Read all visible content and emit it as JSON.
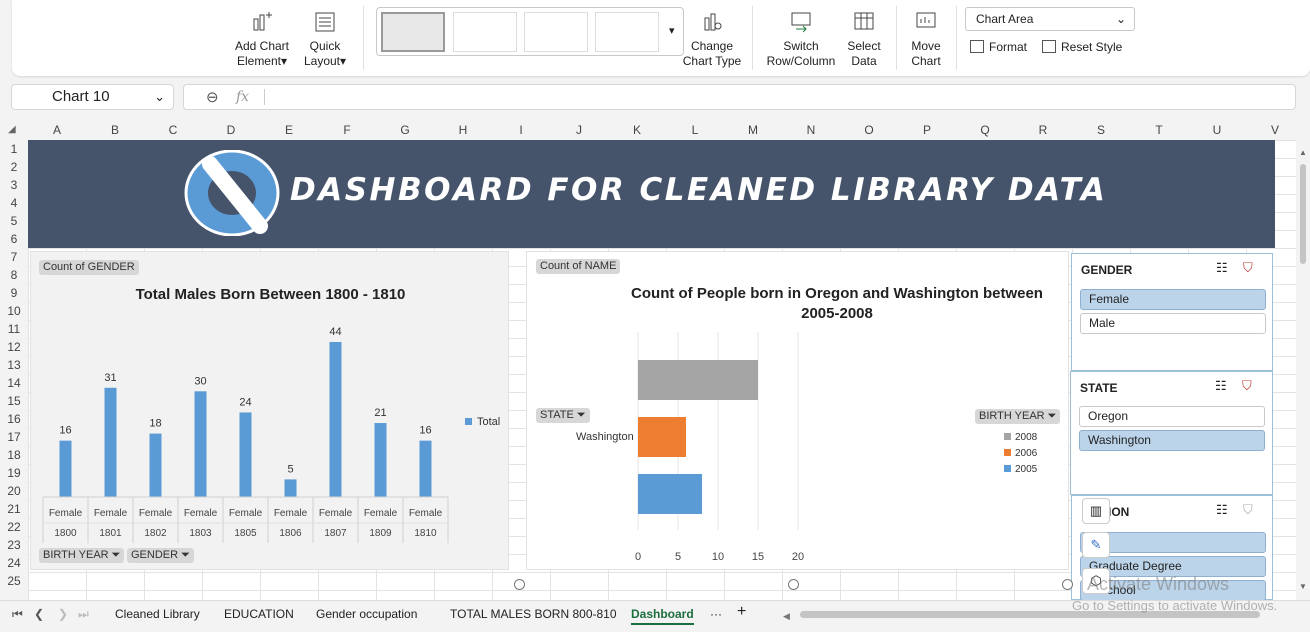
{
  "ribbon": {
    "add_chart_element": "Add Chart Element",
    "add_chart_element_l1": "Add Chart",
    "add_chart_element_l2": "Element",
    "quick_layout_l1": "Quick",
    "quick_layout_l2": "Layout",
    "change_chart_type_l1": "Change",
    "change_chart_type_l2": "Chart Type",
    "switch_row_col_l1": "Switch",
    "switch_row_col_l2": "Row/Column",
    "select_data_l1": "Select",
    "select_data_l2": "Data",
    "move_chart_l1": "Move",
    "move_chart_l2": "Chart",
    "chart_element_select": "Chart Area",
    "format": "Format",
    "reset_style": "Reset Style"
  },
  "formula_bar": {
    "name_box": "Chart 10",
    "fx": "fx",
    "value": ""
  },
  "grid": {
    "columns": [
      "A",
      "B",
      "C",
      "D",
      "E",
      "F",
      "G",
      "H",
      "I",
      "J",
      "K",
      "L",
      "M",
      "N",
      "O",
      "P",
      "Q",
      "R",
      "S",
      "T",
      "U",
      "V"
    ],
    "rows": [
      "1",
      "2",
      "3",
      "4",
      "5",
      "6",
      "7",
      "8",
      "9",
      "10",
      "11",
      "12",
      "13",
      "14",
      "15",
      "16",
      "17",
      "18",
      "19",
      "20",
      "21",
      "22",
      "23",
      "24",
      "25"
    ]
  },
  "banner": {
    "title": "DASHBOARD FOR CLEANED LIBRARY DATA"
  },
  "chart_left": {
    "field_chip": "Count of GENDER",
    "axis_chip_1": "BIRTH YEAR",
    "axis_chip_2": "GENDER",
    "legend": "Total"
  },
  "chart_right": {
    "field_chip": "Count of NAME",
    "title_l1": "Count of People born in Oregon and Washington between",
    "title_l2": "2005-2008",
    "row_chip": "STATE",
    "category_label": "Washington",
    "legend_chip": "BIRTH YEAR"
  },
  "chart_data": [
    {
      "type": "bar",
      "title": "Total Males Born Between 1800 - 1810",
      "categories": [
        "1800",
        "1801",
        "1802",
        "1803",
        "1805",
        "1806",
        "1807",
        "1809",
        "1810"
      ],
      "category_group": "Female",
      "series": [
        {
          "name": "Total",
          "values": [
            16,
            31,
            18,
            30,
            24,
            5,
            44,
            21,
            16
          ],
          "color": "#5b9bd5"
        }
      ],
      "legend": "right"
    },
    {
      "type": "bar",
      "orientation": "horizontal",
      "title": "Count of People born in Oregon and Washington between 2005-2008",
      "categories": [
        "Washington"
      ],
      "series": [
        {
          "name": "2008",
          "values": [
            15
          ],
          "color": "#a5a5a5"
        },
        {
          "name": "2006",
          "values": [
            6
          ],
          "color": "#ed7d31"
        },
        {
          "name": "2005",
          "values": [
            8
          ],
          "color": "#5b9bd5"
        }
      ],
      "xlim": [
        0,
        20
      ],
      "xticks": [
        "0",
        "5",
        "10",
        "15",
        "20"
      ],
      "legend": "right"
    }
  ],
  "slicers": {
    "gender": {
      "title": "GENDER",
      "items": [
        "Female",
        "Male"
      ],
      "selected": [
        true,
        false
      ]
    },
    "state": {
      "title": "STATE",
      "items": [
        "Oregon",
        "Washington"
      ],
      "selected": [
        false,
        true
      ]
    },
    "education": {
      "title": "EDUCATION",
      "title_visible": "E    ATION",
      "items": [
        "College",
        "Graduate Degree",
        "High School"
      ],
      "items_visible": [
        "   ege",
        "Graduate Degree",
        "   h School"
      ]
    }
  },
  "tabs": {
    "sheets": [
      "Cleaned Library",
      "EDUCATION",
      "Gender occupation",
      "TOTAL MALES BORN 800-810",
      "Dashboard"
    ],
    "active": "Dashboard",
    "more": "···",
    "add": "+"
  },
  "watermark": {
    "line1": "Activate Windows",
    "line2": "Go to Settings to activate Windows."
  }
}
